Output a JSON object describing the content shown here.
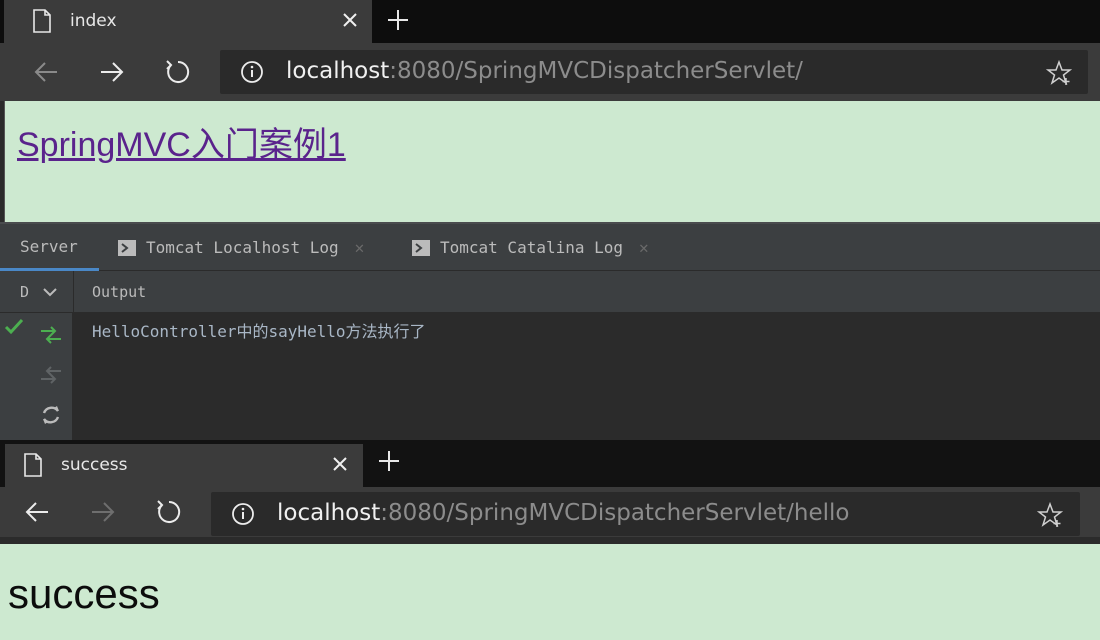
{
  "top_browser": {
    "tab_title": "index",
    "url_host": "localhost",
    "url_rest": ":8080/SpringMVCDispatcherServlet/",
    "page_link": "SpringMVC入门案例1"
  },
  "ide": {
    "tabs": [
      {
        "label": "Server"
      },
      {
        "label": "Tomcat Localhost Log"
      },
      {
        "label": "Tomcat Catalina Log"
      }
    ],
    "sub_d": "D",
    "sub_output": "Output",
    "log_line": "HelloController中的sayHello方法执行了"
  },
  "bottom_browser": {
    "tab_title": "success",
    "url_host": "localhost",
    "url_rest": ":8080/SpringMVCDispatcherServlet/hello",
    "page_text": "success"
  },
  "colors": {
    "page_bg": "#cde9d0",
    "link": "#5a238c",
    "chrome": "#3b3b3b",
    "ide_accent_green": "#4caf50"
  },
  "icons": [
    "document-icon",
    "close-icon",
    "plus-icon",
    "back-arrow-icon",
    "forward-arrow-icon",
    "refresh-icon",
    "info-icon",
    "star-icon",
    "terminal-icon",
    "chevron-down-icon",
    "checkmark-icon",
    "deploy-icon",
    "undeploy-icon",
    "sync-icon"
  ]
}
